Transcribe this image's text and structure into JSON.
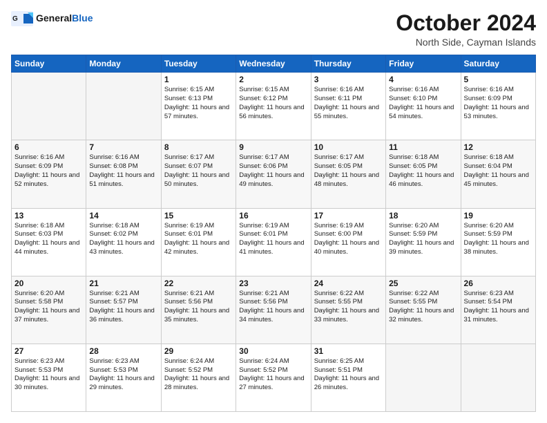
{
  "header": {
    "logo_general": "General",
    "logo_blue": "Blue",
    "month_title": "October 2024",
    "location": "North Side, Cayman Islands"
  },
  "days_of_week": [
    "Sunday",
    "Monday",
    "Tuesday",
    "Wednesday",
    "Thursday",
    "Friday",
    "Saturday"
  ],
  "weeks": [
    [
      {
        "day": "",
        "sunrise": "",
        "sunset": "",
        "daylight": ""
      },
      {
        "day": "",
        "sunrise": "",
        "sunset": "",
        "daylight": ""
      },
      {
        "day": "1",
        "sunrise": "Sunrise: 6:15 AM",
        "sunset": "Sunset: 6:13 PM",
        "daylight": "Daylight: 11 hours and 57 minutes."
      },
      {
        "day": "2",
        "sunrise": "Sunrise: 6:15 AM",
        "sunset": "Sunset: 6:12 PM",
        "daylight": "Daylight: 11 hours and 56 minutes."
      },
      {
        "day": "3",
        "sunrise": "Sunrise: 6:16 AM",
        "sunset": "Sunset: 6:11 PM",
        "daylight": "Daylight: 11 hours and 55 minutes."
      },
      {
        "day": "4",
        "sunrise": "Sunrise: 6:16 AM",
        "sunset": "Sunset: 6:10 PM",
        "daylight": "Daylight: 11 hours and 54 minutes."
      },
      {
        "day": "5",
        "sunrise": "Sunrise: 6:16 AM",
        "sunset": "Sunset: 6:09 PM",
        "daylight": "Daylight: 11 hours and 53 minutes."
      }
    ],
    [
      {
        "day": "6",
        "sunrise": "Sunrise: 6:16 AM",
        "sunset": "Sunset: 6:09 PM",
        "daylight": "Daylight: 11 hours and 52 minutes."
      },
      {
        "day": "7",
        "sunrise": "Sunrise: 6:16 AM",
        "sunset": "Sunset: 6:08 PM",
        "daylight": "Daylight: 11 hours and 51 minutes."
      },
      {
        "day": "8",
        "sunrise": "Sunrise: 6:17 AM",
        "sunset": "Sunset: 6:07 PM",
        "daylight": "Daylight: 11 hours and 50 minutes."
      },
      {
        "day": "9",
        "sunrise": "Sunrise: 6:17 AM",
        "sunset": "Sunset: 6:06 PM",
        "daylight": "Daylight: 11 hours and 49 minutes."
      },
      {
        "day": "10",
        "sunrise": "Sunrise: 6:17 AM",
        "sunset": "Sunset: 6:05 PM",
        "daylight": "Daylight: 11 hours and 48 minutes."
      },
      {
        "day": "11",
        "sunrise": "Sunrise: 6:18 AM",
        "sunset": "Sunset: 6:05 PM",
        "daylight": "Daylight: 11 hours and 46 minutes."
      },
      {
        "day": "12",
        "sunrise": "Sunrise: 6:18 AM",
        "sunset": "Sunset: 6:04 PM",
        "daylight": "Daylight: 11 hours and 45 minutes."
      }
    ],
    [
      {
        "day": "13",
        "sunrise": "Sunrise: 6:18 AM",
        "sunset": "Sunset: 6:03 PM",
        "daylight": "Daylight: 11 hours and 44 minutes."
      },
      {
        "day": "14",
        "sunrise": "Sunrise: 6:18 AM",
        "sunset": "Sunset: 6:02 PM",
        "daylight": "Daylight: 11 hours and 43 minutes."
      },
      {
        "day": "15",
        "sunrise": "Sunrise: 6:19 AM",
        "sunset": "Sunset: 6:01 PM",
        "daylight": "Daylight: 11 hours and 42 minutes."
      },
      {
        "day": "16",
        "sunrise": "Sunrise: 6:19 AM",
        "sunset": "Sunset: 6:01 PM",
        "daylight": "Daylight: 11 hours and 41 minutes."
      },
      {
        "day": "17",
        "sunrise": "Sunrise: 6:19 AM",
        "sunset": "Sunset: 6:00 PM",
        "daylight": "Daylight: 11 hours and 40 minutes."
      },
      {
        "day": "18",
        "sunrise": "Sunrise: 6:20 AM",
        "sunset": "Sunset: 5:59 PM",
        "daylight": "Daylight: 11 hours and 39 minutes."
      },
      {
        "day": "19",
        "sunrise": "Sunrise: 6:20 AM",
        "sunset": "Sunset: 5:59 PM",
        "daylight": "Daylight: 11 hours and 38 minutes."
      }
    ],
    [
      {
        "day": "20",
        "sunrise": "Sunrise: 6:20 AM",
        "sunset": "Sunset: 5:58 PM",
        "daylight": "Daylight: 11 hours and 37 minutes."
      },
      {
        "day": "21",
        "sunrise": "Sunrise: 6:21 AM",
        "sunset": "Sunset: 5:57 PM",
        "daylight": "Daylight: 11 hours and 36 minutes."
      },
      {
        "day": "22",
        "sunrise": "Sunrise: 6:21 AM",
        "sunset": "Sunset: 5:56 PM",
        "daylight": "Daylight: 11 hours and 35 minutes."
      },
      {
        "day": "23",
        "sunrise": "Sunrise: 6:21 AM",
        "sunset": "Sunset: 5:56 PM",
        "daylight": "Daylight: 11 hours and 34 minutes."
      },
      {
        "day": "24",
        "sunrise": "Sunrise: 6:22 AM",
        "sunset": "Sunset: 5:55 PM",
        "daylight": "Daylight: 11 hours and 33 minutes."
      },
      {
        "day": "25",
        "sunrise": "Sunrise: 6:22 AM",
        "sunset": "Sunset: 5:55 PM",
        "daylight": "Daylight: 11 hours and 32 minutes."
      },
      {
        "day": "26",
        "sunrise": "Sunrise: 6:23 AM",
        "sunset": "Sunset: 5:54 PM",
        "daylight": "Daylight: 11 hours and 31 minutes."
      }
    ],
    [
      {
        "day": "27",
        "sunrise": "Sunrise: 6:23 AM",
        "sunset": "Sunset: 5:53 PM",
        "daylight": "Daylight: 11 hours and 30 minutes."
      },
      {
        "day": "28",
        "sunrise": "Sunrise: 6:23 AM",
        "sunset": "Sunset: 5:53 PM",
        "daylight": "Daylight: 11 hours and 29 minutes."
      },
      {
        "day": "29",
        "sunrise": "Sunrise: 6:24 AM",
        "sunset": "Sunset: 5:52 PM",
        "daylight": "Daylight: 11 hours and 28 minutes."
      },
      {
        "day": "30",
        "sunrise": "Sunrise: 6:24 AM",
        "sunset": "Sunset: 5:52 PM",
        "daylight": "Daylight: 11 hours and 27 minutes."
      },
      {
        "day": "31",
        "sunrise": "Sunrise: 6:25 AM",
        "sunset": "Sunset: 5:51 PM",
        "daylight": "Daylight: 11 hours and 26 minutes."
      },
      {
        "day": "",
        "sunrise": "",
        "sunset": "",
        "daylight": ""
      },
      {
        "day": "",
        "sunrise": "",
        "sunset": "",
        "daylight": ""
      }
    ]
  ]
}
